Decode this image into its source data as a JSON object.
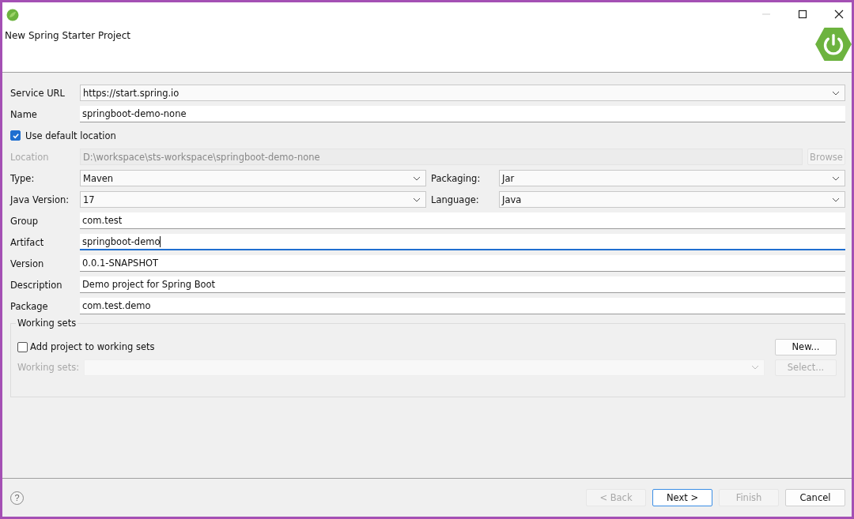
{
  "window": {
    "title": "New Spring Starter Project"
  },
  "form": [
    {
      "kind": "combo",
      "label": "Service URL",
      "value": "https://start.spring.io"
    },
    {
      "kind": "text",
      "label": "Name",
      "value": "springboot-demo-none",
      "focused": false
    },
    {
      "kind": "checkbox",
      "label": "Use default location",
      "checked": true
    },
    {
      "kind": "path",
      "label": "Location",
      "value": "D:\\workspace\\sts-workspace\\springboot-demo-none",
      "disabled": true,
      "button": "Browse"
    },
    {
      "kind": "pair",
      "left": {
        "label": "Type:",
        "value": "Maven"
      },
      "right": {
        "label": "Packaging:",
        "value": "Jar"
      }
    },
    {
      "kind": "pair",
      "left": {
        "label": "Java Version:",
        "value": "17"
      },
      "right": {
        "label": "Language:",
        "value": "Java"
      }
    },
    {
      "kind": "text",
      "label": "Group",
      "value": "com.test",
      "focused": false
    },
    {
      "kind": "text",
      "label": "Artifact",
      "value": "springboot-demo",
      "focused": true
    },
    {
      "kind": "text",
      "label": "Version",
      "value": "0.0.1-SNAPSHOT",
      "focused": false
    },
    {
      "kind": "text",
      "label": "Description",
      "value": "Demo project for Spring Boot",
      "focused": false
    },
    {
      "kind": "text",
      "label": "Package",
      "value": "com.test.demo",
      "focused": false
    }
  ],
  "working_sets": {
    "title": "Working sets",
    "add": {
      "label": "Add project to working sets",
      "checked": false
    },
    "new_button": {
      "label": "New...",
      "disabled": false
    },
    "sets_label": "Working sets:",
    "select_button": {
      "label": "Select...",
      "disabled": true
    }
  },
  "footer": {
    "help": "?",
    "buttons": [
      {
        "label": "< Back",
        "disabled": true,
        "default": false
      },
      {
        "label": "Next >",
        "disabled": false,
        "default": true
      },
      {
        "label": "Finish",
        "disabled": true,
        "default": false
      },
      {
        "label": "Cancel",
        "disabled": false,
        "default": false
      }
    ]
  }
}
